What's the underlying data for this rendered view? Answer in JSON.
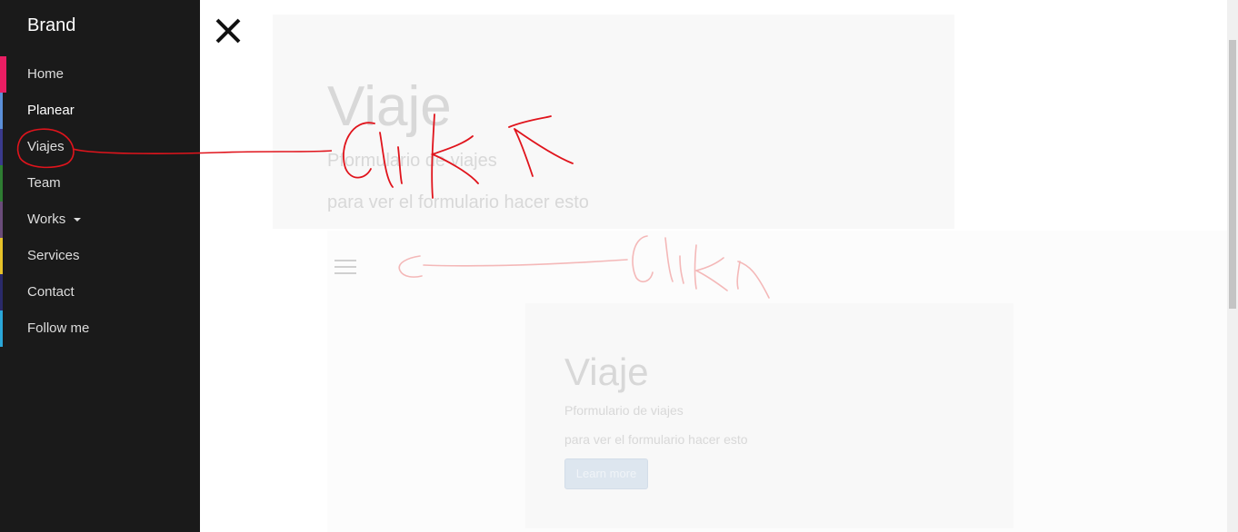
{
  "sidebar": {
    "brand": "Brand",
    "items": [
      {
        "label": "Home",
        "color": "#e91e63"
      },
      {
        "label": "Planear",
        "color": "#5b8fd9"
      },
      {
        "label": "Viajes",
        "color": "#3a3a8c"
      },
      {
        "label": "Team",
        "color": "#2e7d32"
      },
      {
        "label": "Works",
        "color": "#6a4c7a"
      },
      {
        "label": "Services",
        "color": "#e6c229"
      },
      {
        "label": "Contact",
        "color": "#2a2a6a"
      },
      {
        "label": "Follow me",
        "color": "#2aa7d9"
      }
    ]
  },
  "jumbotron": {
    "title": "Viaje",
    "subtitle": "Pformulario de viajes",
    "description": "para ver el formulario hacer esto"
  },
  "card": {
    "title": "Viaje",
    "subtitle": "Pformulario de viajes",
    "description": "para ver el formulario hacer esto",
    "button_label": "Learn more"
  },
  "annotations": {
    "click_label": "Click",
    "color": "#e0141c",
    "faded_color": "#f4b8b8"
  },
  "icons": {
    "close": "close-icon",
    "menu": "hamburger-menu-icon",
    "caret": "caret-down-icon"
  }
}
